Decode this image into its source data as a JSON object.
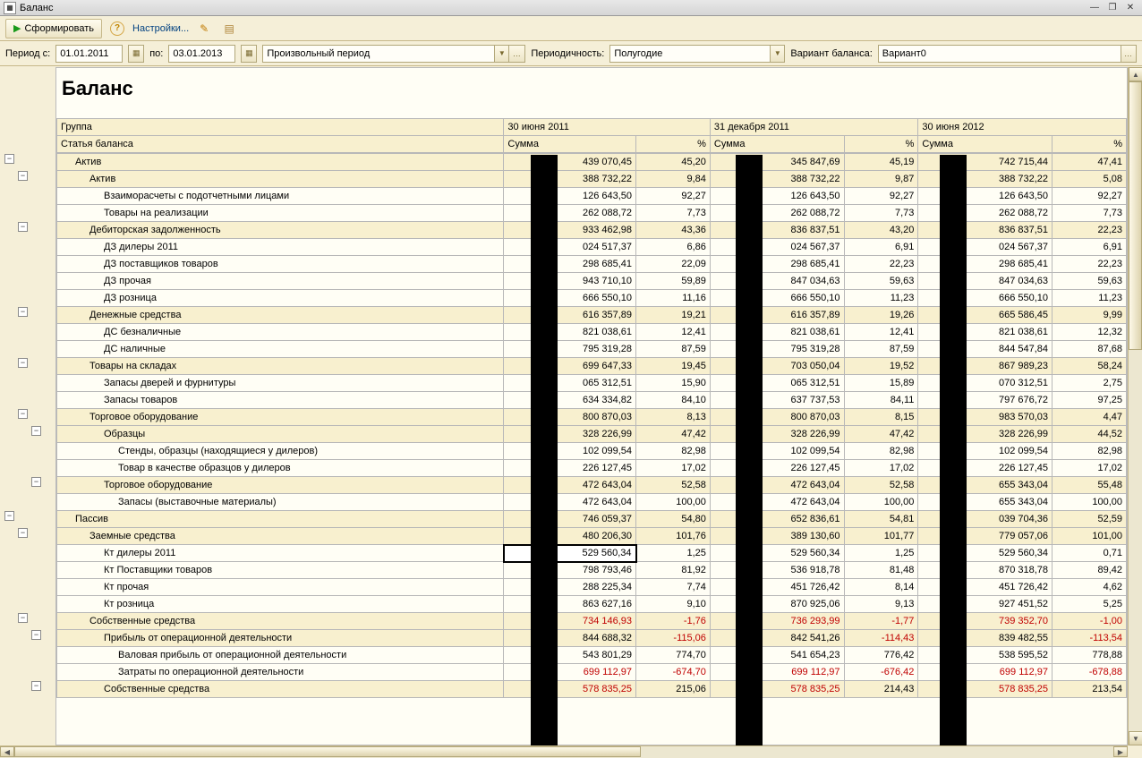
{
  "window": {
    "title": "Баланс"
  },
  "toolbar": {
    "form": "Сформировать",
    "settings": "Настройки..."
  },
  "period": {
    "label_from": "Период с:",
    "from": "01.01.2011",
    "label_to": "по:",
    "to": "03.01.2013",
    "free_period": "Произвольный период",
    "periodicity_label": "Периодичность:",
    "periodicity": "Полугодие",
    "variant_label": "Вариант баланса:",
    "variant": "Вариант0"
  },
  "report": {
    "title": "Баланс",
    "h_group": "Группа",
    "h_article": "Статья баланса",
    "periods": [
      "30 июня 2011",
      "31 декабря 2011",
      "30 июня 2012"
    ],
    "h_sum": "Сумма",
    "h_pct": "%"
  },
  "rows": [
    {
      "lvl": 1,
      "g": true,
      "name": "Актив",
      "v": [
        "439 070,45",
        "45,20",
        "345 847,69",
        "45,19",
        "742 715,44",
        "47,41"
      ]
    },
    {
      "lvl": 2,
      "g": true,
      "name": "Актив",
      "v": [
        "388 732,22",
        "9,84",
        "388 732,22",
        "9,87",
        "388 732,22",
        "5,08"
      ]
    },
    {
      "lvl": 3,
      "g": false,
      "name": "Взаиморасчеты с подотчетными лицами",
      "v": [
        "126 643,50",
        "92,27",
        "126 643,50",
        "92,27",
        "126 643,50",
        "92,27"
      ]
    },
    {
      "lvl": 3,
      "g": false,
      "name": "Товары на реализации",
      "v": [
        "262 088,72",
        "7,73",
        "262 088,72",
        "7,73",
        "262 088,72",
        "7,73"
      ]
    },
    {
      "lvl": 2,
      "g": true,
      "name": "Дебиторская задолженность",
      "v": [
        "933 462,98",
        "43,36",
        "836 837,51",
        "43,20",
        "836 837,51",
        "22,23"
      ]
    },
    {
      "lvl": 3,
      "g": false,
      "name": "ДЗ дилеры 2011",
      "v": [
        "024 517,37",
        "6,86",
        "024 567,37",
        "6,91",
        "024 567,37",
        "6,91"
      ]
    },
    {
      "lvl": 3,
      "g": false,
      "name": "ДЗ поставщиков товаров",
      "v": [
        "298 685,41",
        "22,09",
        "298 685,41",
        "22,23",
        "298 685,41",
        "22,23"
      ]
    },
    {
      "lvl": 3,
      "g": false,
      "name": "ДЗ прочая",
      "v": [
        "943 710,10",
        "59,89",
        "847 034,63",
        "59,63",
        "847 034,63",
        "59,63"
      ]
    },
    {
      "lvl": 3,
      "g": false,
      "name": "ДЗ розница",
      "v": [
        "666 550,10",
        "11,16",
        "666 550,10",
        "11,23",
        "666 550,10",
        "11,23"
      ]
    },
    {
      "lvl": 2,
      "g": true,
      "name": "Денежные средства",
      "v": [
        "616 357,89",
        "19,21",
        "616 357,89",
        "19,26",
        "665 586,45",
        "9,99"
      ]
    },
    {
      "lvl": 3,
      "g": false,
      "name": "ДС безналичные",
      "v": [
        "821 038,61",
        "12,41",
        "821 038,61",
        "12,41",
        "821 038,61",
        "12,32"
      ]
    },
    {
      "lvl": 3,
      "g": false,
      "name": "ДС наличные",
      "v": [
        "795 319,28",
        "87,59",
        "795 319,28",
        "87,59",
        "844 547,84",
        "87,68"
      ]
    },
    {
      "lvl": 2,
      "g": true,
      "name": "Товары на складах",
      "v": [
        "699 647,33",
        "19,45",
        "703 050,04",
        "19,52",
        "867 989,23",
        "58,24"
      ]
    },
    {
      "lvl": 3,
      "g": false,
      "name": "Запасы дверей и фурнитуры",
      "v": [
        "065 312,51",
        "15,90",
        "065 312,51",
        "15,89",
        "070 312,51",
        "2,75"
      ]
    },
    {
      "lvl": 3,
      "g": false,
      "name": "Запасы товаров",
      "v": [
        "634 334,82",
        "84,10",
        "637 737,53",
        "84,11",
        "797 676,72",
        "97,25"
      ]
    },
    {
      "lvl": 2,
      "g": true,
      "name": "Торговое оборудование",
      "v": [
        "800 870,03",
        "8,13",
        "800 870,03",
        "8,15",
        "983 570,03",
        "4,47"
      ]
    },
    {
      "lvl": 3,
      "g": true,
      "name": "Образцы",
      "v": [
        "328 226,99",
        "47,42",
        "328 226,99",
        "47,42",
        "328 226,99",
        "44,52"
      ]
    },
    {
      "lvl": 4,
      "g": false,
      "name": "Стенды, образцы (находящиеся у дилеров)",
      "v": [
        "102 099,54",
        "82,98",
        "102 099,54",
        "82,98",
        "102 099,54",
        "82,98"
      ]
    },
    {
      "lvl": 4,
      "g": false,
      "name": "Товар в качестве образцов у дилеров",
      "v": [
        "226 127,45",
        "17,02",
        "226 127,45",
        "17,02",
        "226 127,45",
        "17,02"
      ]
    },
    {
      "lvl": 3,
      "g": true,
      "name": "Торговое оборудование",
      "v": [
        "472 643,04",
        "52,58",
        "472 643,04",
        "52,58",
        "655 343,04",
        "55,48"
      ]
    },
    {
      "lvl": 4,
      "g": false,
      "name": "Запасы (выставочные материалы)",
      "v": [
        "472 643,04",
        "100,00",
        "472 643,04",
        "100,00",
        "655 343,04",
        "100,00"
      ]
    },
    {
      "lvl": 1,
      "g": true,
      "name": "Пассив",
      "v": [
        "746 059,37",
        "54,80",
        "652 836,61",
        "54,81",
        "039 704,36",
        "52,59"
      ]
    },
    {
      "lvl": 2,
      "g": true,
      "name": "Заемные средства",
      "v": [
        "480 206,30",
        "101,76",
        "389 130,60",
        "101,77",
        "779 057,06",
        "101,00"
      ]
    },
    {
      "lvl": 3,
      "g": false,
      "sel": true,
      "name": "Кт дилеры 2011",
      "v": [
        "529 560,34",
        "1,25",
        "529 560,34",
        "1,25",
        "529 560,34",
        "0,71"
      ]
    },
    {
      "lvl": 3,
      "g": false,
      "name": "Кт Поставщики товаров",
      "v": [
        "798 793,46",
        "81,92",
        "536 918,78",
        "81,48",
        "870 318,78",
        "89,42"
      ]
    },
    {
      "lvl": 3,
      "g": false,
      "name": "Кт прочая",
      "v": [
        "288 225,34",
        "7,74",
        "451 726,42",
        "8,14",
        "451 726,42",
        "4,62"
      ]
    },
    {
      "lvl": 3,
      "g": false,
      "name": "Кт розница",
      "v": [
        "863 627,16",
        "9,10",
        "870 925,06",
        "9,13",
        "927 451,52",
        "5,25"
      ]
    },
    {
      "lvl": 2,
      "g": true,
      "name": "Собственные средства",
      "neg": [
        0,
        1,
        2,
        3,
        4,
        5
      ],
      "v": [
        "734 146,93",
        "-1,76",
        "736 293,99",
        "-1,77",
        "739 352,70",
        "-1,00"
      ]
    },
    {
      "lvl": 3,
      "g": true,
      "name": "Прибыль от операционной деятельности",
      "neg": [
        1,
        3,
        5
      ],
      "v": [
        "844 688,32",
        "-115,06",
        "842 541,26",
        "-114,43",
        "839 482,55",
        "-113,54"
      ]
    },
    {
      "lvl": 4,
      "g": false,
      "name": "Валовая прибыль от операционной  деятельности",
      "v": [
        "543 801,29",
        "774,70",
        "541 654,23",
        "776,42",
        "538 595,52",
        "778,88"
      ]
    },
    {
      "lvl": 4,
      "g": false,
      "name": "Затраты по операционной деятельности",
      "neg": [
        0,
        1,
        2,
        3,
        4,
        5
      ],
      "v": [
        "699 112,97",
        "-674,70",
        "699 112,97",
        "-676,42",
        "699 112,97",
        "-678,88"
      ]
    },
    {
      "lvl": 3,
      "g": true,
      "name": "Собственные средства",
      "neg": [
        0,
        2,
        4
      ],
      "v": [
        "578 835,25",
        "215,06",
        "578 835,25",
        "214,43",
        "578 835,25",
        "213,54"
      ]
    }
  ],
  "tree_buttons": [
    {
      "x": 5,
      "row": 0,
      "sym": "−"
    },
    {
      "x": 20,
      "row": 1,
      "sym": "−"
    },
    {
      "x": 20,
      "row": 4,
      "sym": "−"
    },
    {
      "x": 20,
      "row": 9,
      "sym": "−"
    },
    {
      "x": 20,
      "row": 12,
      "sym": "−"
    },
    {
      "x": 20,
      "row": 15,
      "sym": "−"
    },
    {
      "x": 35,
      "row": 16,
      "sym": "−"
    },
    {
      "x": 35,
      "row": 19,
      "sym": "−"
    },
    {
      "x": 5,
      "row": 21,
      "sym": "−"
    },
    {
      "x": 20,
      "row": 22,
      "sym": "−"
    },
    {
      "x": 20,
      "row": 27,
      "sym": "−"
    },
    {
      "x": 35,
      "row": 28,
      "sym": "−"
    },
    {
      "x": 35,
      "row": 31,
      "sym": "−"
    }
  ]
}
